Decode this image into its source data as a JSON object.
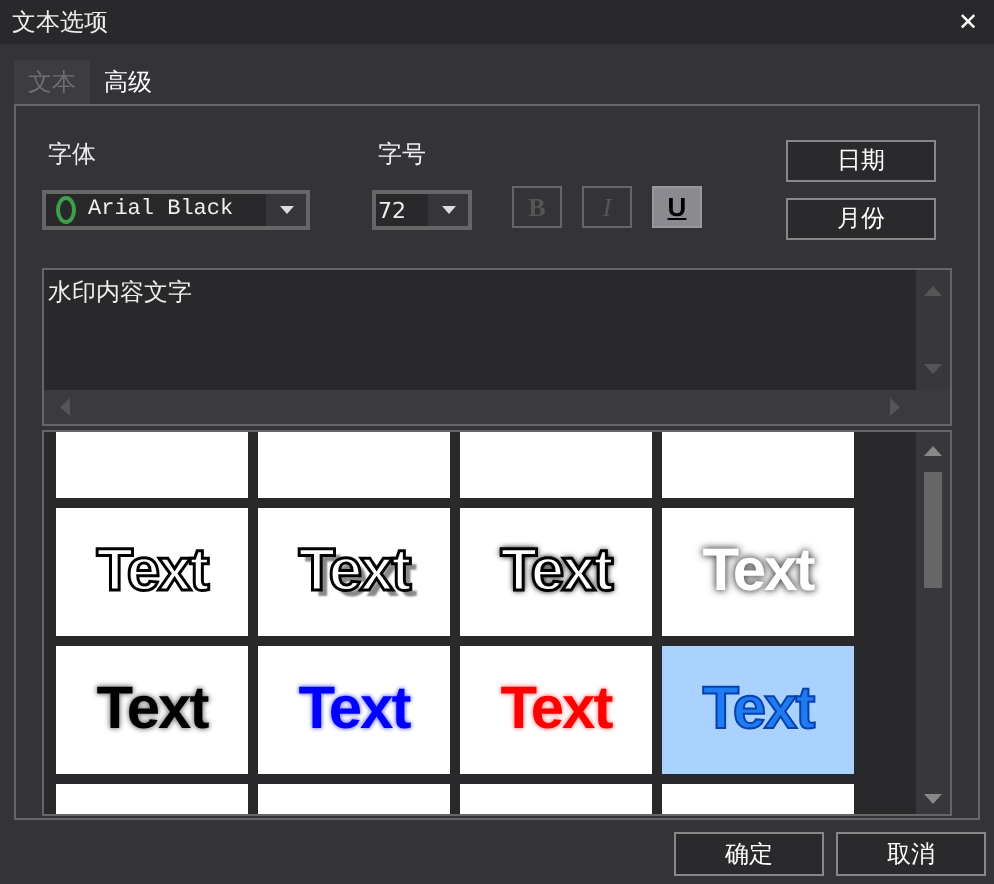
{
  "window": {
    "title": "文本选项",
    "close": "✕"
  },
  "tabs": [
    {
      "label": "文本",
      "selected": true
    },
    {
      "label": "高级",
      "selected": false
    }
  ],
  "font": {
    "label": "字体",
    "value": "Arial Black"
  },
  "size": {
    "label": "字号",
    "value": "72"
  },
  "format_buttons": [
    {
      "label": "B",
      "kind": "bold",
      "on": false
    },
    {
      "label": "I",
      "kind": "italic",
      "on": false
    },
    {
      "label": "U",
      "kind": "underline",
      "on": true
    }
  ],
  "side_buttons": [
    "日期",
    "月份"
  ],
  "content": {
    "value": "水印内容文字"
  },
  "styles": [
    {
      "selected": false
    },
    {
      "selected": false
    },
    {
      "selected": false
    },
    {
      "selected": false
    },
    {
      "label": "Text",
      "selected": false
    },
    {
      "label": "Text",
      "selected": false
    },
    {
      "label": "Text",
      "selected": false
    },
    {
      "label": "Text",
      "selected": false
    },
    {
      "label": "Text",
      "selected": false
    },
    {
      "label": "Text",
      "selected": false
    },
    {
      "label": "Text",
      "selected": false
    },
    {
      "label": "Text",
      "selected": true
    },
    {
      "selected": false
    },
    {
      "selected": false
    },
    {
      "selected": false
    },
    {
      "selected": false
    }
  ],
  "buttons": [
    "确定",
    "取消"
  ]
}
